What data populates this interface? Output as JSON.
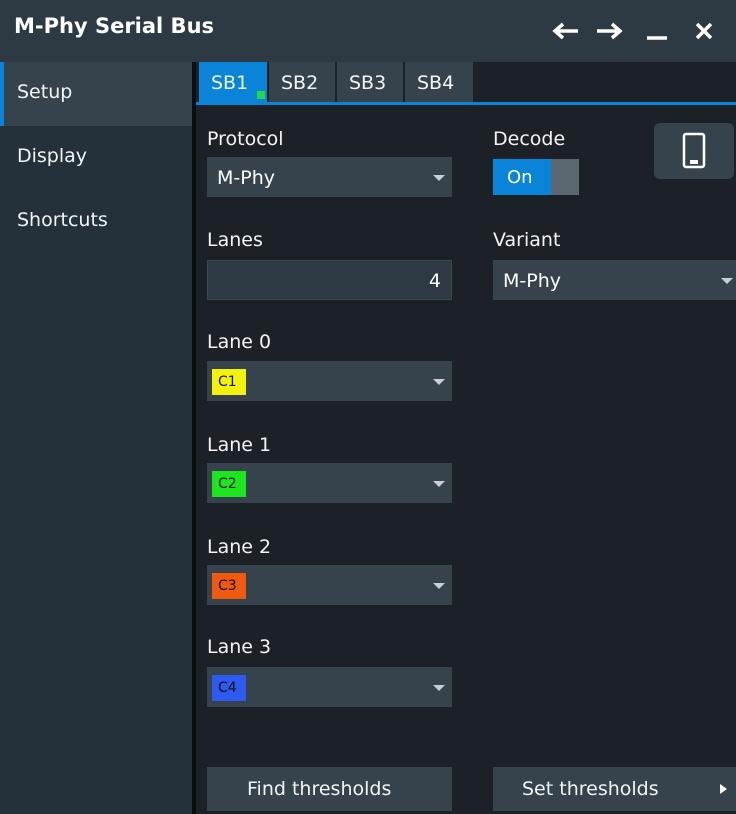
{
  "window": {
    "title": "M-Phy Serial Bus"
  },
  "sidebar": {
    "items": [
      {
        "label": "Setup"
      },
      {
        "label": "Display"
      },
      {
        "label": "Shortcuts"
      }
    ]
  },
  "tabs": [
    {
      "label": "SB1"
    },
    {
      "label": "SB2"
    },
    {
      "label": "SB3"
    },
    {
      "label": "SB4"
    }
  ],
  "protocol": {
    "label": "Protocol",
    "value": "M-Phy"
  },
  "decode": {
    "label": "Decode",
    "value": "On"
  },
  "lanes": {
    "label": "Lanes",
    "value": "4"
  },
  "variant": {
    "label": "Variant",
    "value": "M-Phy"
  },
  "lane_sources": [
    {
      "label": "Lane 0",
      "chip": "C1",
      "color": "#f2f20c"
    },
    {
      "label": "Lane 1",
      "chip": "C2",
      "color": "#1ee61e"
    },
    {
      "label": "Lane 2",
      "chip": "C3",
      "color": "#f05a0f"
    },
    {
      "label": "Lane 3",
      "chip": "C4",
      "color": "#2e5bef"
    }
  ],
  "buttons": {
    "find_thresholds": "Find thresholds",
    "set_thresholds": "Set thresholds"
  },
  "icons": [
    "back-arrow-icon",
    "forward-arrow-icon",
    "minimize-icon",
    "close-icon",
    "phone-icon",
    "chevron-down-icon",
    "right-triangle-icon"
  ],
  "colors": {
    "accent": "#0a84d8",
    "panel": "#1b2126",
    "field": "#36434d"
  }
}
